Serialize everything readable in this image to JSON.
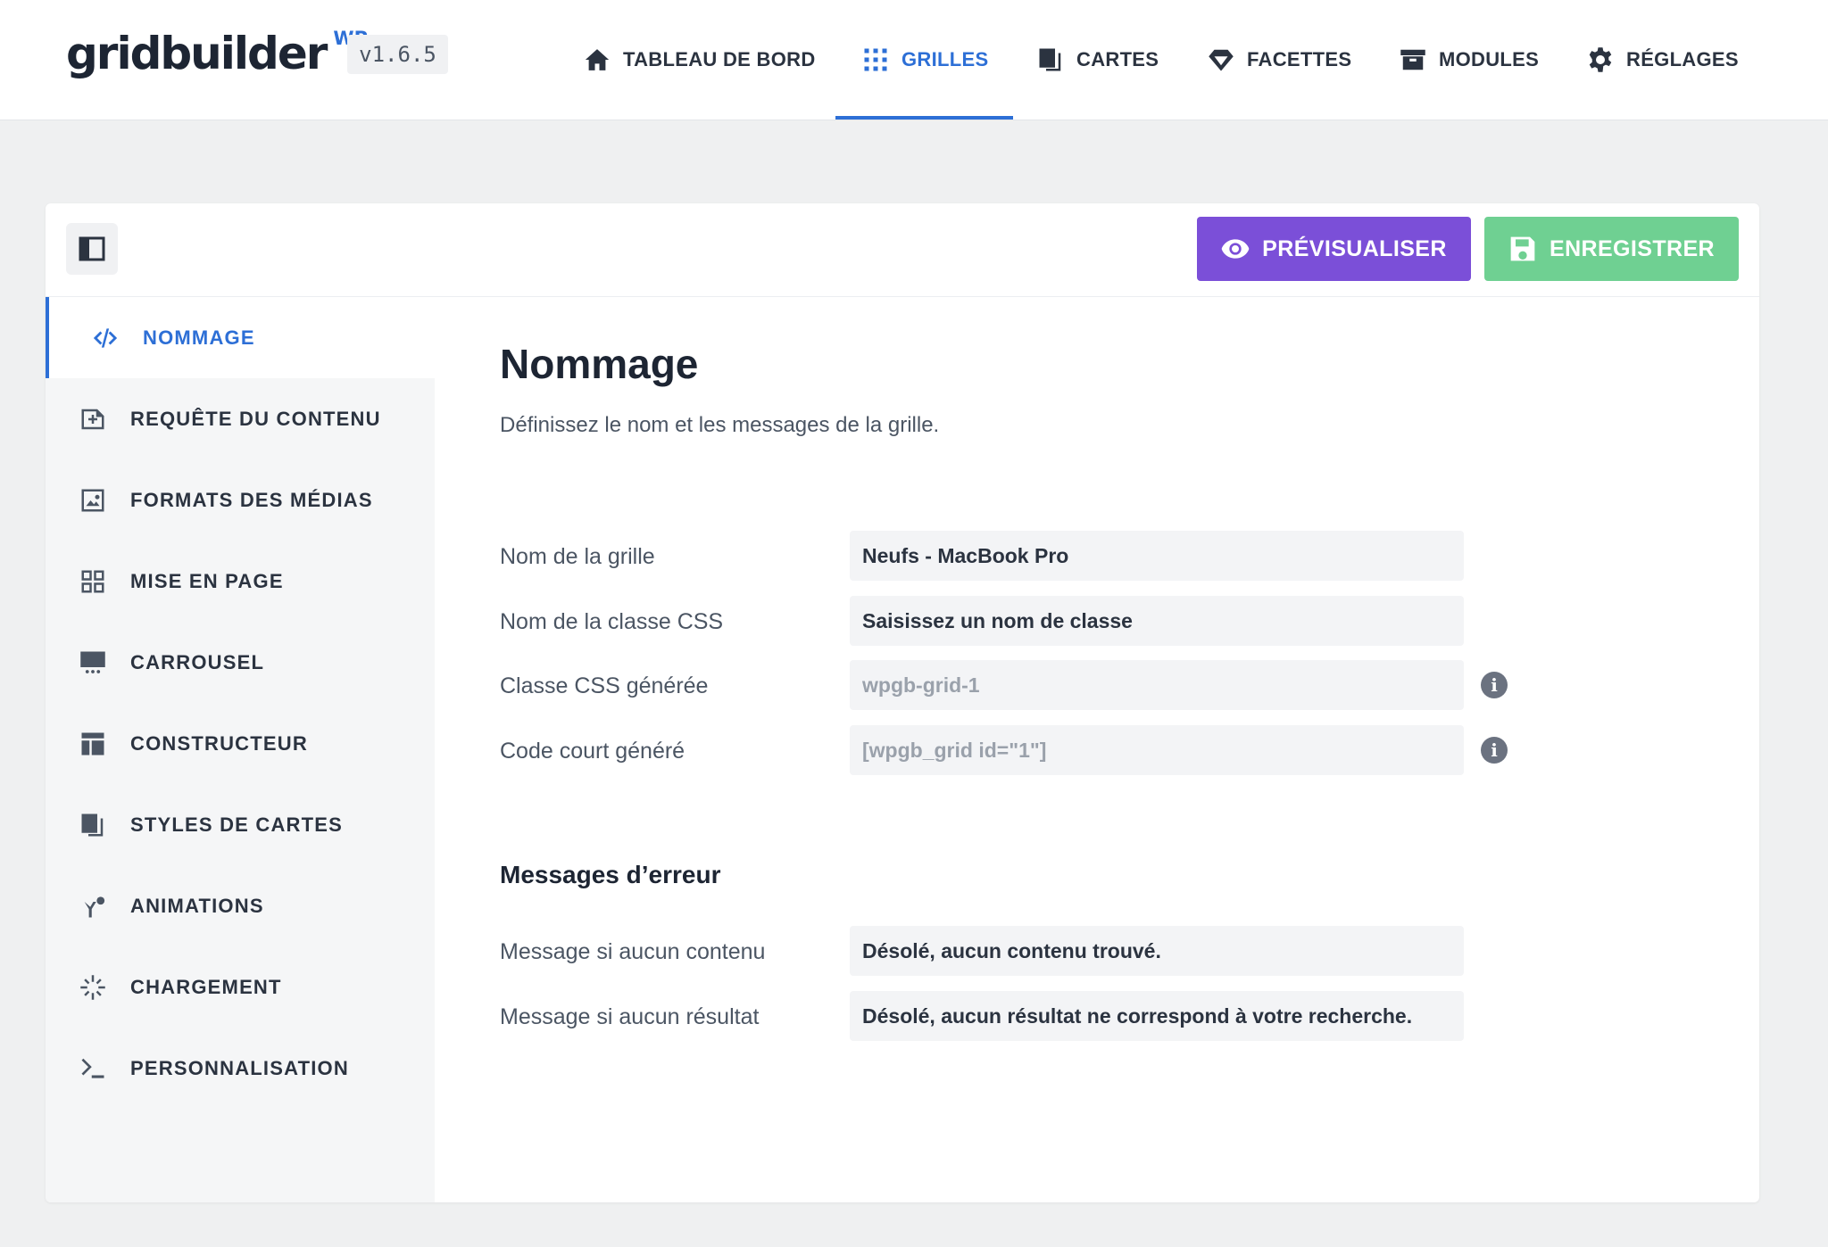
{
  "app": {
    "logo_text": "gridbuilder",
    "logo_sup": "WP",
    "version": "v1.6.5"
  },
  "nav": [
    {
      "label": "TABLEAU DE BORD",
      "icon": "home-icon"
    },
    {
      "label": "GRILLES",
      "icon": "grid-icon",
      "active": true
    },
    {
      "label": "CARTES",
      "icon": "cards-icon"
    },
    {
      "label": "FACETTES",
      "icon": "diamond-icon"
    },
    {
      "label": "MODULES",
      "icon": "archive-icon"
    },
    {
      "label": "RÉGLAGES",
      "icon": "gear-icon"
    }
  ],
  "toolbar": {
    "preview_label": "PRÉVISUALISER",
    "save_label": "ENREGISTRER"
  },
  "sidebar": {
    "items": [
      {
        "label": "NOMMAGE",
        "icon": "code-icon",
        "active": true
      },
      {
        "label": "REQUÊTE DU CONTENU",
        "icon": "add-file-icon"
      },
      {
        "label": "FORMATS DES MÉDIAS",
        "icon": "image-icon"
      },
      {
        "label": "MISE EN PAGE",
        "icon": "layout-grid-icon"
      },
      {
        "label": "CARROUSEL",
        "icon": "carousel-icon"
      },
      {
        "label": "CONSTRUCTEUR",
        "icon": "builder-icon"
      },
      {
        "label": "STYLES DE CARTES",
        "icon": "cards-icon"
      },
      {
        "label": "ANIMATIONS",
        "icon": "animation-icon"
      },
      {
        "label": "CHARGEMENT",
        "icon": "spinner-icon"
      },
      {
        "label": "PERSONNALISATION",
        "icon": "terminal-icon"
      }
    ]
  },
  "main": {
    "title": "Nommage",
    "description": "Définissez le nom et les messages de la grille.",
    "fields": {
      "grid_name": {
        "label": "Nom de la grille",
        "value": "Neufs - MacBook Pro"
      },
      "css_class": {
        "label": "Nom de la classe CSS",
        "placeholder": "Saisissez un nom de classe"
      },
      "generated_css": {
        "label": "Classe CSS générée",
        "value": "wpgb-grid-1"
      },
      "shortcode": {
        "label": "Code court généré",
        "value": "[wpgb_grid id=\"1\"]"
      }
    },
    "errors_title": "Messages d’erreur",
    "errors": {
      "no_content": {
        "label": "Message si aucun contenu",
        "value": "Désolé, aucun contenu trouvé."
      },
      "no_result": {
        "label": "Message si aucun résultat",
        "value": "Désolé, aucun résultat ne correspond à votre recherche."
      }
    }
  },
  "colors": {
    "accent": "#2d6fd6",
    "preview_button": "#7b4fd8",
    "save_button": "#6fd092",
    "background": "#eff0f1"
  }
}
